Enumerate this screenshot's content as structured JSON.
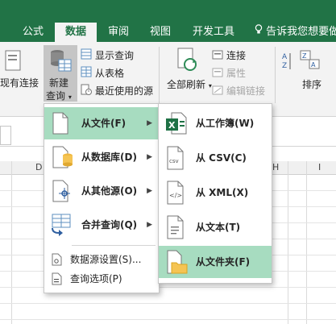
{
  "tabs": [
    {
      "label": "公式",
      "active": false
    },
    {
      "label": "数据",
      "active": true
    },
    {
      "label": "审阅",
      "active": false
    },
    {
      "label": "视图",
      "active": false
    },
    {
      "label": "开发工具",
      "active": false
    }
  ],
  "tell_me": "告诉我您想要做",
  "ribbon": {
    "existing_connections": "现有连接",
    "new_query_line1": "新建",
    "new_query_line2": "查询",
    "show_queries": "显示查询",
    "from_table": "从表格",
    "recent_sources": "最近使用的源",
    "refresh_all": "全部刷新",
    "connections": "连接",
    "properties": "属性",
    "edit_links": "编辑链接",
    "sort": "排序"
  },
  "columns": [
    "D",
    "H",
    "I"
  ],
  "menu": {
    "items": [
      {
        "label": "从文件(F)",
        "selected": true,
        "has_submenu": true
      },
      {
        "label": "从数据库(D)",
        "selected": false,
        "has_submenu": true
      },
      {
        "label": "从其他源(O)",
        "selected": false,
        "has_submenu": true
      },
      {
        "label": "合并查询(Q)",
        "selected": false,
        "has_submenu": true
      }
    ],
    "small_items": [
      {
        "label": "数据源设置(S)..."
      },
      {
        "label": "查询选项(P)"
      }
    ]
  },
  "submenu": {
    "items": [
      {
        "label": "从工作簿(W)",
        "selected": false
      },
      {
        "label": "从 CSV(C)",
        "selected": false
      },
      {
        "label": "从 XML(X)",
        "selected": false
      },
      {
        "label": "从文本(T)",
        "selected": false
      },
      {
        "label": "从文件夹(F)",
        "selected": true
      }
    ]
  },
  "colors": {
    "excel_green": "#217346",
    "highlight": "#a7dcc0",
    "ribbon_bg": "#f3f3f3"
  }
}
